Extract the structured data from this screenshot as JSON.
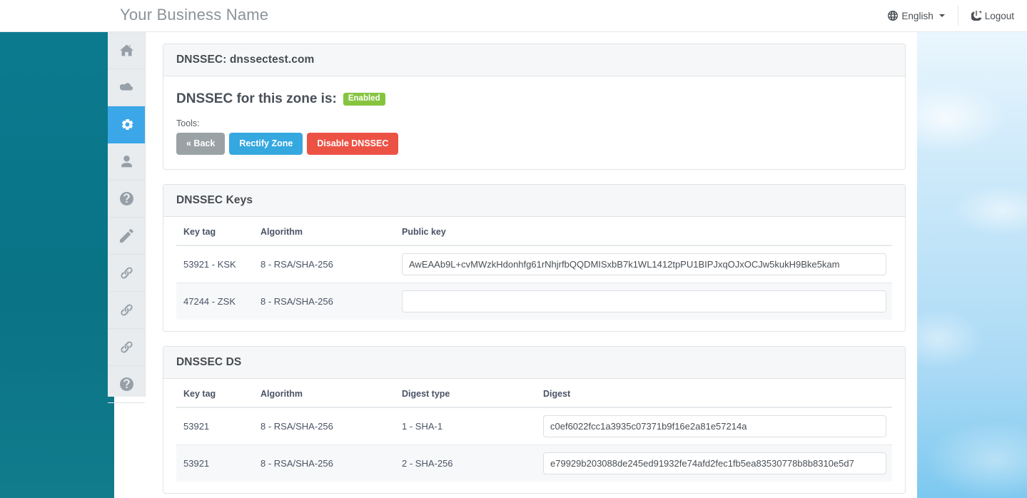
{
  "navbar": {
    "brand": "Your Business Name",
    "language": {
      "label": "English",
      "icon": "globe-icon"
    },
    "logout": {
      "label": "Logout",
      "icon": "power-icon"
    }
  },
  "sidebar": {
    "items": [
      {
        "icon": "home-icon",
        "name": "home",
        "active": false
      },
      {
        "icon": "cloud-icon",
        "name": "cloud",
        "active": false
      },
      {
        "icon": "gear-icon",
        "name": "settings",
        "active": true
      },
      {
        "icon": "user-icon",
        "name": "user",
        "active": false
      },
      {
        "icon": "question-circle-icon",
        "name": "help",
        "active": false
      },
      {
        "icon": "pencil-icon",
        "name": "edit",
        "active": false
      },
      {
        "icon": "link-icon",
        "name": "link-1",
        "active": false
      },
      {
        "icon": "link-icon",
        "name": "link-2",
        "active": false
      },
      {
        "icon": "link-icon",
        "name": "link-3",
        "active": false
      },
      {
        "icon": "question-circle-icon",
        "name": "help-2",
        "active": false
      }
    ]
  },
  "dnssec_panel": {
    "title": "DNSSEC: dnssectest.com",
    "status_label": "DNSSEC for this zone is:",
    "status_value": "Enabled",
    "tools_label": "Tools:",
    "buttons": {
      "back": "« Back",
      "rectify": "Rectify Zone",
      "disable": "Disable DNSSEC"
    }
  },
  "keys_panel": {
    "title": "DNSSEC Keys",
    "columns": [
      "Key tag",
      "Algorithm",
      "Public key"
    ],
    "rows": [
      {
        "key_tag": "53921 - KSK",
        "algorithm": "8 - RSA/SHA-256",
        "public_key": "AwEAAb9L+cvMWzkHdonhfg61rNhjrfbQQDMISxbB7k1WL1412tpPU1BIPJxqOJxOCJw5kukH9Bke5kam"
      },
      {
        "key_tag": "47244 - ZSK",
        "algorithm": "8 - RSA/SHA-256",
        "public_key": ""
      }
    ]
  },
  "ds_panel": {
    "title": "DNSSEC DS",
    "columns": [
      "Key tag",
      "Algorithm",
      "Digest type",
      "Digest"
    ],
    "rows": [
      {
        "key_tag": "53921",
        "algorithm": "8 - RSA/SHA-256",
        "digest_type": "1 - SHA-1",
        "digest": "c0ef6022fcc1a3935c07371b9f16e2a81e57214a"
      },
      {
        "key_tag": "53921",
        "algorithm": "8 - RSA/SHA-256",
        "digest_type": "2 - SHA-256",
        "digest": "e79929b203088de245ed91932fe74afd2fec1fb5ea83530778b8b8310e5d7"
      }
    ]
  },
  "colors": {
    "accent_blue": "#35a8e0",
    "danger_red": "#ec5244",
    "muted_gray": "#9aa2a6",
    "success_green": "#86c440",
    "sidebar_bg": "#e8ecef",
    "teal_bg": "#0a7386"
  }
}
